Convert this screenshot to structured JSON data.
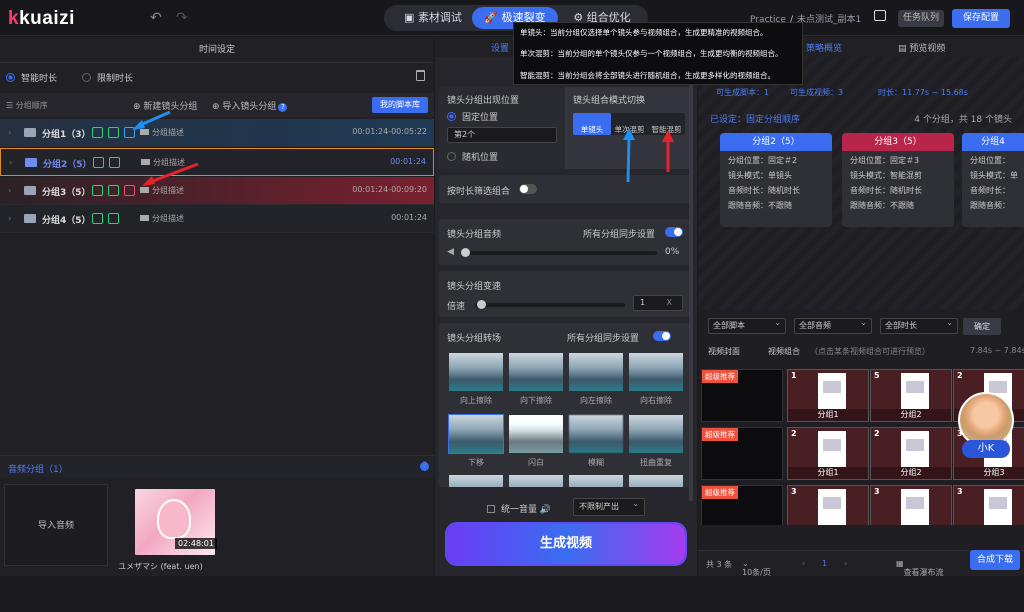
{
  "header": {
    "logo": "kuaizi",
    "tabs": [
      {
        "label": "素材调试"
      },
      {
        "label": "极速裂变"
      },
      {
        "label": "组合优化"
      }
    ],
    "project": "Practice",
    "separator": "/",
    "project_name": "未点测试_副本1",
    "queue_label": "任务队列",
    "save_label": "保存配置"
  },
  "left": {
    "title": "时间设定",
    "mode_smart": "智能时长",
    "mode_limit": "限制时长",
    "sort_label": "分组顺序",
    "new_group": "新建镜头分组",
    "import_group": "导入镜头分组",
    "my_library": "我的脚本库",
    "groups": [
      {
        "name": "分组1（3）",
        "desc": "分组描述",
        "time": "00:01:24-00:05:22"
      },
      {
        "name": "分组2（5）",
        "desc": "分组描述",
        "time": "00:01:24"
      },
      {
        "name": "分组3（5）",
        "desc": "分组描述",
        "time": "00:01:24-00:09:20"
      },
      {
        "name": "分组4（5）",
        "desc": "分组描述",
        "time": "00:01:24"
      }
    ],
    "audio_title": "音频分组（1）",
    "import_audio": "导入音频",
    "audio_duration": "02:48:01",
    "audio_name": "ユメザマシ (feat. uen)"
  },
  "middle": {
    "top_tab": "设置",
    "position_title": "镜头分组出现位置",
    "fixed_pos": "固定位置",
    "fixed_value": "第2个",
    "random_pos": "随机位置",
    "combo_title": "镜头组合模式切换",
    "combo_modes": [
      "单镜头",
      "单次混剪",
      "智能混剪"
    ],
    "filter_label": "按时长筛选组合",
    "audio_label": "镜头分组音频",
    "sync_label": "所有分组同步设置",
    "volume_pct": "0%",
    "speed_title": "镜头分组变速",
    "speed_label": "倍速",
    "speed_value": "1",
    "transition_title": "镜头分组转场",
    "transitions": [
      "向上擦除",
      "向下擦除",
      "向左擦除",
      "向右擦除",
      "下移",
      "闪白",
      "模糊",
      "扭曲重复"
    ],
    "unify_volume": "统一音量",
    "limit_output": "不限制产出",
    "generate": "生成视频"
  },
  "tooltip": [
    "单镜头：当前分组仅选择单个镜头参与视频组合，生成更精准的视频组合。",
    "单次混剪：当前分组的单个镜头仅参与一个视频组合，生成更均衡的视频组合。",
    "智能混剪：当前分组会将全部镜头进行随机组合，生成更多样化的视频组合。"
  ],
  "right": {
    "tab_overview": "策略概览",
    "tab_preview": "预览视频",
    "stat_scripts": "可生成脚本：1",
    "stat_videos": "可生成视频：3",
    "stat_duration": "时长：11.77s ~ 15.68s",
    "set_order": "已设定：固定分组顺序",
    "count": "4 个分组，共 18 个镜头",
    "cards": [
      {
        "title": "分组2（5）",
        "lines": [
          "分组位置：固定＃2",
          "镜头模式：单镜头",
          "音频时长：随机时长",
          "跟随音频：不跟随"
        ]
      },
      {
        "title": "分组3（5）",
        "lines": [
          "分组位置：固定＃3",
          "镜头模式：智能混剪",
          "音频时长：随机时长",
          "跟随音频：不跟随"
        ]
      },
      {
        "title": "分组4",
        "lines": [
          "分组位置：",
          "镜头模式：单",
          "音频时长：",
          "跟随音频："
        ]
      }
    ],
    "filters": [
      "全部脚本",
      "全部音频",
      "全部时长"
    ],
    "confirm": "确定",
    "cover_label": "视频封面",
    "combo_label": "视频组合",
    "combo_hint": "（点击某条视频组合可进行预览）",
    "range": "7.84s ~ 7.84s",
    "badge": "超级推荐",
    "rows": [
      {
        "clips": [
          {
            "num": "1",
            "cap": "分组1"
          },
          {
            "num": "5",
            "cap": "分组2"
          },
          {
            "num": "2",
            "cap": "分组3"
          }
        ]
      },
      {
        "clips": [
          {
            "num": "2",
            "cap": "分组1"
          },
          {
            "num": "2",
            "cap": "分组2"
          },
          {
            "num": "3",
            "cap": "分组3"
          }
        ]
      },
      {
        "clips": [
          {
            "num": "3",
            "cap": "分组1"
          },
          {
            "num": "3",
            "cap": "分组2"
          },
          {
            "num": "3",
            "cap": "分组3"
          }
        ]
      }
    ],
    "avatar_name": "小K",
    "total": "共 3 条",
    "per_page": "10条/页",
    "page": "1",
    "waterfall": "查看瀑布流",
    "download": "合成下载"
  },
  "colors": {
    "accent": "#3a6df0",
    "selected_border": "#e08a1a",
    "group3_tint": "#7a2030",
    "card2_head": "#3a6df0",
    "card3_head": "#b8244a"
  }
}
